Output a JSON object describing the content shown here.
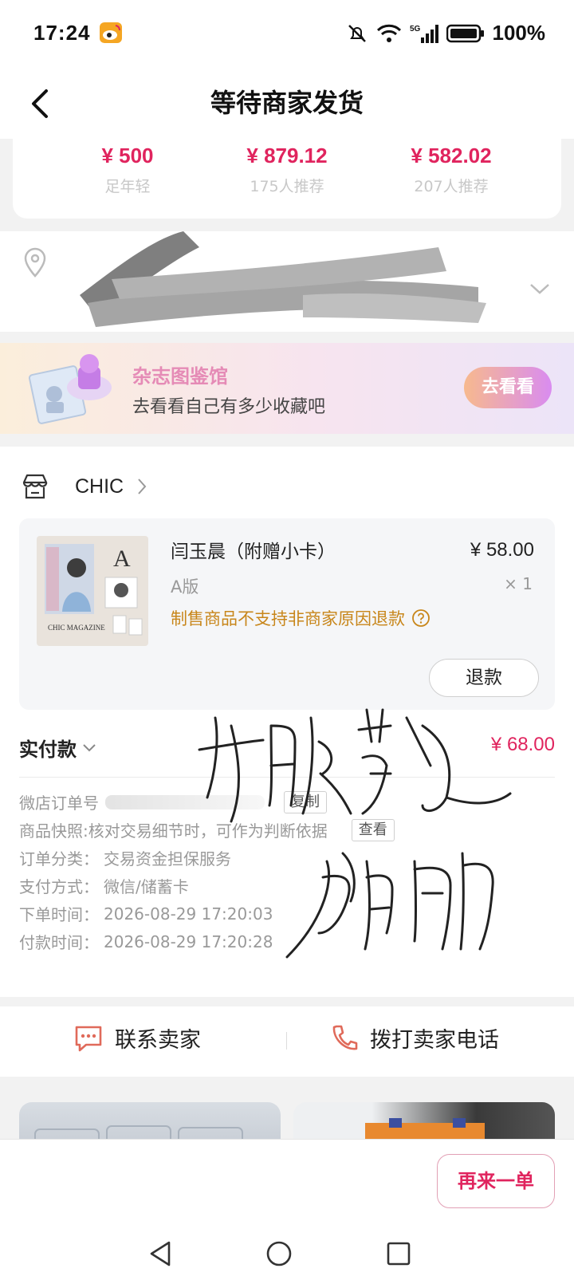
{
  "status_bar": {
    "time": "17:24",
    "battery": "100%",
    "network": "5G"
  },
  "nav": {
    "title": "等待商家发货"
  },
  "recommendations": [
    {
      "price": "¥ 500",
      "sub": "足年轻"
    },
    {
      "price": "¥ 879.12",
      "sub": "175人推荐"
    },
    {
      "price": "¥ 582.02",
      "sub": "207人推荐"
    }
  ],
  "banner": {
    "title": "杂志图鉴馆",
    "subtitle": "去看看自己有多少收藏吧",
    "button": "去看看"
  },
  "shop": {
    "name": "CHIC"
  },
  "product": {
    "title": "闫玉晨（附赠小卡）",
    "price": "¥ 58.00",
    "variant": "A版",
    "quantity": "× 1",
    "notice": "制售商品不支持非商家原因退款",
    "refund_button": "退款",
    "thumb_caption": "CHIC MAGAZINE"
  },
  "payment": {
    "label": "实付款",
    "amount": "¥ 68.00"
  },
  "order_info": {
    "order_no_label": "微店订单号",
    "copy_button": "复制",
    "snapshot_label": "商品快照:",
    "snapshot_value": "核对交易细节时，可作为判断依据",
    "snapshot_button": "查看",
    "category_label": "订单分类：",
    "category_value": "交易资金担保服务",
    "pay_method_label": "支付方式：",
    "pay_method_value": "微信/储蓄卡",
    "order_time_label": "下单时间：",
    "order_time_value": "2026-08-29 17:20:03",
    "pay_time_label": "付款时间：",
    "pay_time_value": "2026-08-29 17:20:28"
  },
  "contact": {
    "contact_seller": "联系卖家",
    "call_seller": "拨打卖家电话"
  },
  "bottom": {
    "reorder_button": "再来一单"
  },
  "colors": {
    "accent": "#e0245e",
    "notice": "#c8861a",
    "banner_title": "#e58bb6"
  }
}
